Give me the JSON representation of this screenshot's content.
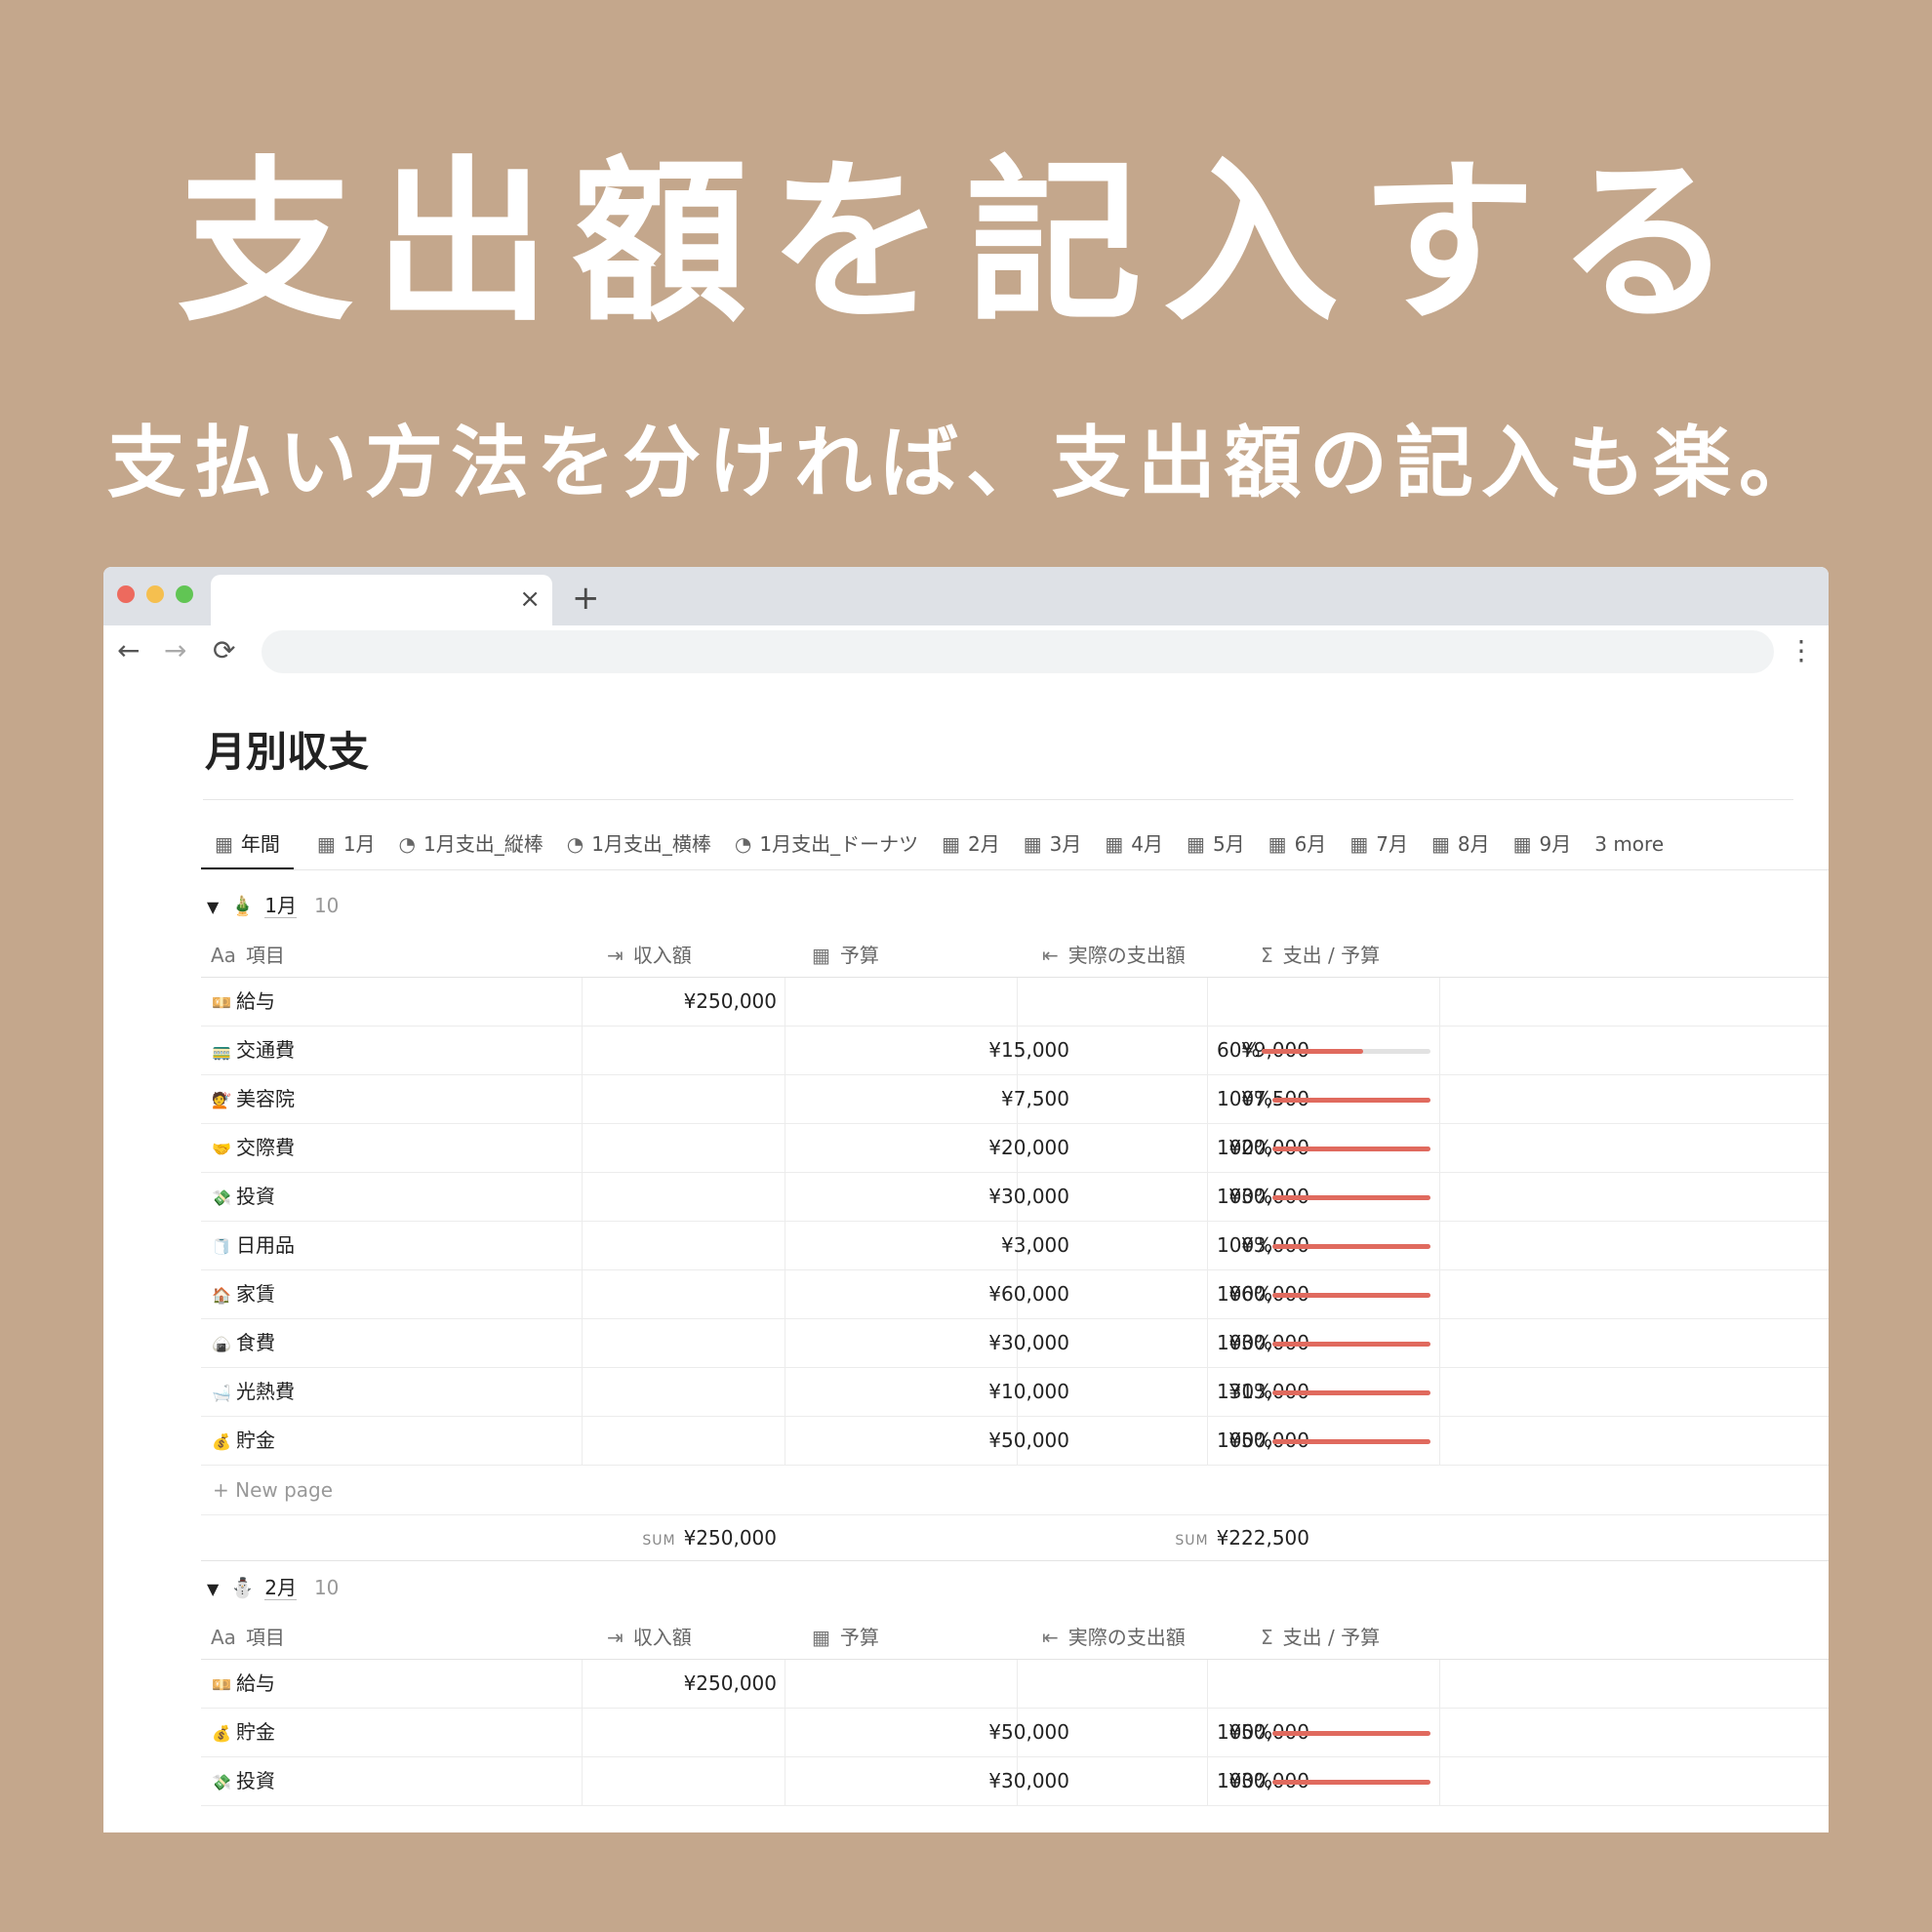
{
  "headline": "支出額を記入する",
  "subline": "支払い方法を分ければ、支出額の記入も楽。",
  "browser": {
    "tab_close": "×",
    "new_tab": "+",
    "back": "←",
    "forward": "→",
    "reload": "⟳",
    "menu": "⋮"
  },
  "page": {
    "title": "月別収支"
  },
  "views": [
    {
      "icon": "▦",
      "label": "年間"
    },
    {
      "icon": "▦",
      "label": "1月"
    },
    {
      "icon": "◔",
      "label": "1月支出_縦棒"
    },
    {
      "icon": "◔",
      "label": "1月支出_横棒"
    },
    {
      "icon": "◔",
      "label": "1月支出_ドーナツ"
    },
    {
      "icon": "▦",
      "label": "2月"
    },
    {
      "icon": "▦",
      "label": "3月"
    },
    {
      "icon": "▦",
      "label": "4月"
    },
    {
      "icon": "▦",
      "label": "5月"
    },
    {
      "icon": "▦",
      "label": "6月"
    },
    {
      "icon": "▦",
      "label": "7月"
    },
    {
      "icon": "▦",
      "label": "8月"
    },
    {
      "icon": "▦",
      "label": "9月"
    }
  ],
  "views_more": "3 more",
  "columns": {
    "name_icon": "Aa",
    "name": "項目",
    "income_icon": "⇥",
    "income": "収入額",
    "budget_icon": "▦",
    "budget": "予算",
    "actual_icon": "⇤",
    "actual": "実際の支出額",
    "ratio_icon": "Σ",
    "ratio": "支出 / 予算"
  },
  "groups": [
    {
      "triangle": "▼",
      "emoji": "🎍",
      "name": "1月",
      "count": "10",
      "rows": [
        {
          "emoji": "💴",
          "name": "給与",
          "income": "¥250,000",
          "budget": "",
          "actual": "",
          "ratio": "",
          "ratio_value": null
        },
        {
          "emoji": "🚃",
          "name": "交通費",
          "income": "",
          "budget": "¥15,000",
          "actual": "¥9,000",
          "ratio": "60%",
          "ratio_value": 0.6
        },
        {
          "emoji": "💇",
          "name": "美容院",
          "income": "",
          "budget": "¥7,500",
          "actual": "¥7,500",
          "ratio": "100%",
          "ratio_value": 1.0
        },
        {
          "emoji": "🤝",
          "name": "交際費",
          "income": "",
          "budget": "¥20,000",
          "actual": "¥20,000",
          "ratio": "100%",
          "ratio_value": 1.0
        },
        {
          "emoji": "💸",
          "name": "投資",
          "income": "",
          "budget": "¥30,000",
          "actual": "¥30,000",
          "ratio": "100%",
          "ratio_value": 1.0
        },
        {
          "emoji": "🧻",
          "name": "日用品",
          "income": "",
          "budget": "¥3,000",
          "actual": "¥3,000",
          "ratio": "100%",
          "ratio_value": 1.0
        },
        {
          "emoji": "🏠",
          "name": "家賃",
          "income": "",
          "budget": "¥60,000",
          "actual": "¥60,000",
          "ratio": "100%",
          "ratio_value": 1.0
        },
        {
          "emoji": "🍙",
          "name": "食費",
          "income": "",
          "budget": "¥30,000",
          "actual": "¥30,000",
          "ratio": "100%",
          "ratio_value": 1.0
        },
        {
          "emoji": "🛁",
          "name": "光熱費",
          "income": "",
          "budget": "¥10,000",
          "actual": "¥13,000",
          "ratio": "130%",
          "ratio_value": 1.3
        },
        {
          "emoji": "💰",
          "name": "貯金",
          "income": "",
          "budget": "¥50,000",
          "actual": "¥50,000",
          "ratio": "100%",
          "ratio_value": 1.0
        }
      ],
      "new_page": "+  New page",
      "sum_label": "SUM",
      "sum_income": "¥250,000",
      "sum_actual": "¥222,500"
    },
    {
      "triangle": "▼",
      "emoji": "⛄",
      "name": "2月",
      "count": "10",
      "rows": [
        {
          "emoji": "💴",
          "name": "給与",
          "income": "¥250,000",
          "budget": "",
          "actual": "",
          "ratio": "",
          "ratio_value": null
        },
        {
          "emoji": "💰",
          "name": "貯金",
          "income": "",
          "budget": "¥50,000",
          "actual": "¥50,000",
          "ratio": "100%",
          "ratio_value": 1.0
        },
        {
          "emoji": "💸",
          "name": "投資",
          "income": "",
          "budget": "¥30,000",
          "actual": "¥30,000",
          "ratio": "100%",
          "ratio_value": 1.0
        }
      ]
    }
  ]
}
